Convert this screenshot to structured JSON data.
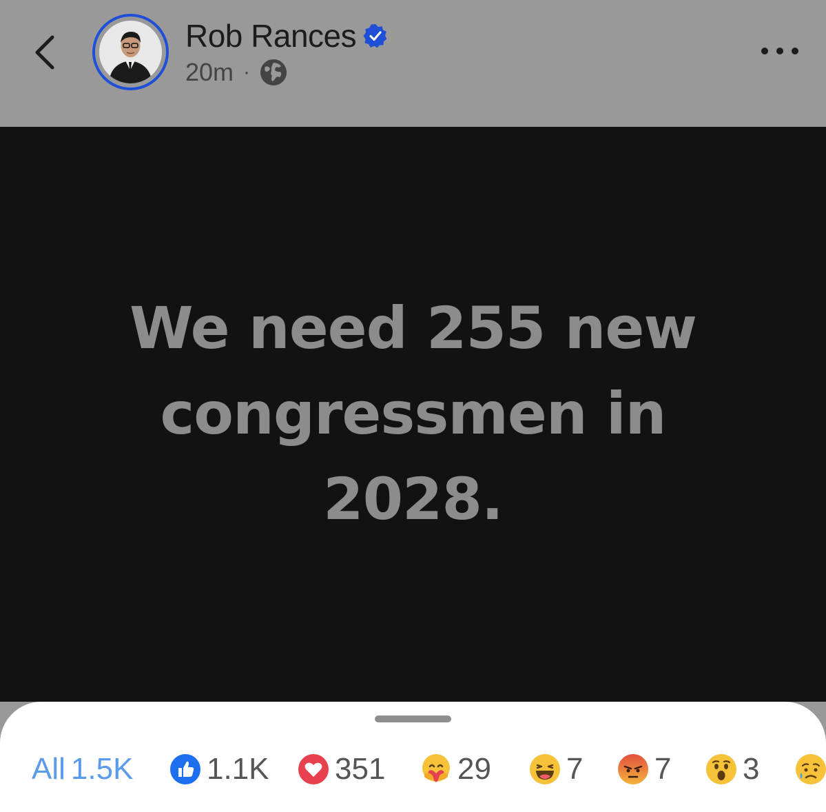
{
  "header": {
    "author_name": "Rob Rances",
    "time": "20m",
    "separator": "·",
    "back_icon": "chevron-left-icon",
    "verified_icon": "verified-badge-icon",
    "audience_icon": "globe-icon",
    "more_icon": "more-horizontal-icon"
  },
  "post": {
    "line1": "We need 255 new",
    "line2": "congressmen in",
    "line3": "2028."
  },
  "reactions": {
    "all": {
      "label": "All",
      "count": "1.5K"
    },
    "like": {
      "icon": "like-icon",
      "count": "1.1K"
    },
    "love": {
      "icon": "love-icon",
      "count": "351"
    },
    "care": {
      "icon": "care-icon",
      "count": "29"
    },
    "haha": {
      "icon": "haha-icon",
      "count": "7"
    },
    "angry": {
      "icon": "angry-icon",
      "count": "7"
    },
    "wow": {
      "icon": "wow-icon",
      "count": "3"
    },
    "sad": {
      "icon": "sad-icon"
    }
  },
  "colors": {
    "header_bg": "#999999",
    "post_bg": "#121212",
    "post_text": "#8c8c8c",
    "accent_blue": "#5a9bea",
    "avatar_ring": "#1f4fd6"
  }
}
